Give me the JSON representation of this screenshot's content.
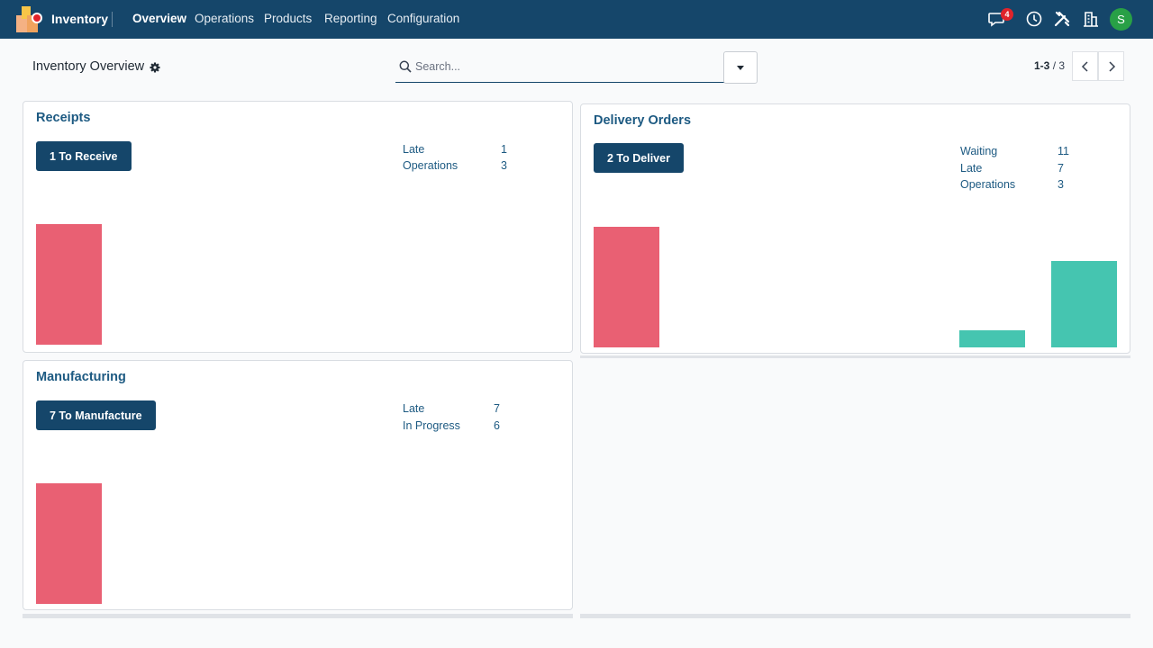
{
  "navbar": {
    "app_name": "Inventory",
    "menus": [
      "Overview",
      "Operations",
      "Products",
      "Reporting",
      "Configuration"
    ],
    "messages_badge": "4",
    "avatar_initial": "S",
    "colors": {
      "bar": "#15466a",
      "badge": "#e0242b",
      "avatar": "#28a046"
    }
  },
  "control_panel": {
    "title": "Inventory Overview",
    "search_placeholder": "Search...",
    "pager_range": "1-3",
    "pager_total": "/ 3"
  },
  "cards": {
    "receipts": {
      "title": "Receipts",
      "button": "1 To Receive",
      "stats": [
        {
          "label": "Late",
          "value": "1"
        },
        {
          "label": "Operations",
          "value": "3"
        }
      ]
    },
    "delivery": {
      "title": "Delivery Orders",
      "button": "2 To Deliver",
      "stats": [
        {
          "label": "Waiting",
          "value": "11"
        },
        {
          "label": "Late",
          "value": "7"
        },
        {
          "label": "Operations",
          "value": "3"
        }
      ]
    },
    "manufacturing": {
      "title": "Manufacturing",
      "button": "7 To Manufacture",
      "stats": [
        {
          "label": "Late",
          "value": "7"
        },
        {
          "label": "In Progress",
          "value": "6"
        }
      ]
    }
  },
  "colors": {
    "late_bar": "#e96073",
    "future_bar": "#45c5b0"
  }
}
